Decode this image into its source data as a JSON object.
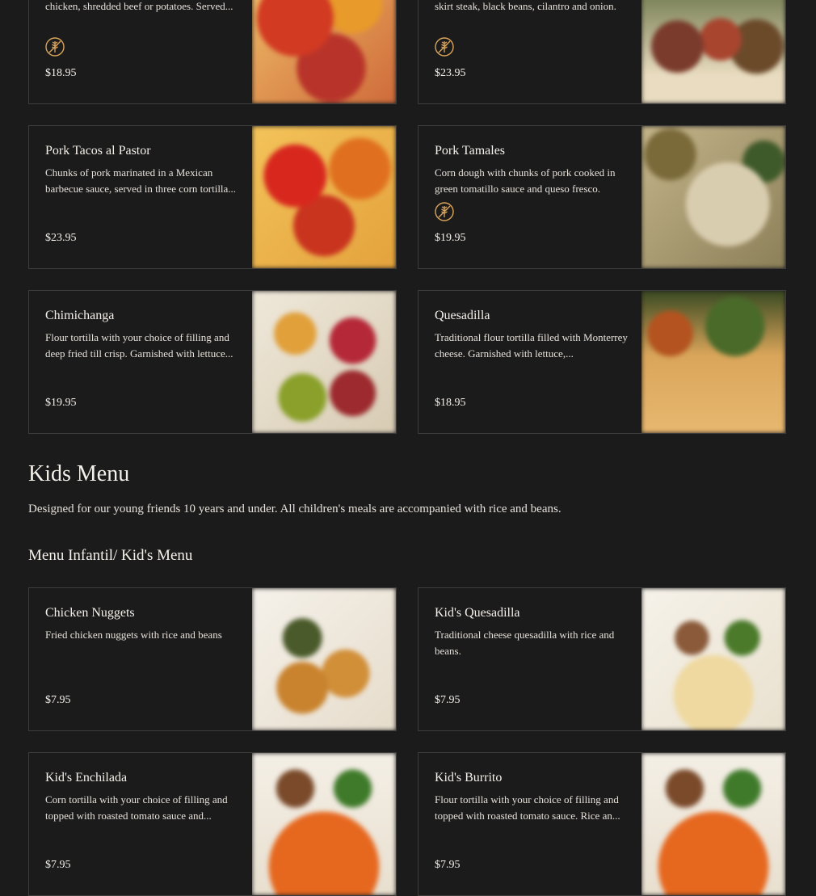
{
  "top_menu": {
    "items": [
      {
        "name": "",
        "description": "Deep fried tacos filled with your choice of chicken, shredded beef or potatoes. Served...",
        "badge": "gluten-free-icon",
        "price": "$18.95"
      },
      {
        "name": "",
        "description": "Three soft corn tortillas filled with grilled skirt steak, black beans, cilantro and onion.",
        "badge": "gluten-free-icon",
        "price": "$23.95"
      },
      {
        "name": "Pork Tacos al Pastor",
        "description": "Chunks of pork marinated in a Mexican barbecue sauce, served in three corn tortilla...",
        "badge": "",
        "price": "$23.95"
      },
      {
        "name": "Pork Tamales",
        "description": "Corn dough with chunks of pork cooked in green tomatillo sauce and queso fresco.",
        "badge": "gluten-free-icon",
        "price": "$19.95"
      },
      {
        "name": "Chimichanga",
        "description": "Flour tortilla with your choice of filling and deep fried till crisp. Garnished with lettuce...",
        "badge": "",
        "price": "$19.95"
      },
      {
        "name": "Quesadilla",
        "description": "Traditional flour tortilla filled with Monterrey cheese. Garnished with lettuce,...",
        "badge": "",
        "price": "$18.95"
      }
    ]
  },
  "kids_section": {
    "title": "Kids Menu",
    "description": "Designed for our young friends 10 years and under. All children's meals are accompanied with rice and beans.",
    "subtitle": "Menu Infantil/ Kid's Menu",
    "items": [
      {
        "name": "Chicken Nuggets",
        "description": "Fried chicken nuggets with rice and beans",
        "price": "$7.95"
      },
      {
        "name": "Kid's Quesadilla",
        "description": "Traditional cheese quesadilla with rice and beans.",
        "price": "$7.95"
      },
      {
        "name": "Kid's Enchilada",
        "description": "Corn tortilla with your choice of filling and topped with roasted tomato sauce and...",
        "price": "$7.95"
      },
      {
        "name": "Kid's Burrito",
        "description": "Flour tortilla with your choice of filling and topped with roasted tomato sauce. Rice an...",
        "price": "$7.95"
      }
    ]
  },
  "colors": {
    "background": "#1c1b1b",
    "text": "#f4f0ea",
    "border": "#3f3d3b",
    "badge": "#d9a45b"
  }
}
